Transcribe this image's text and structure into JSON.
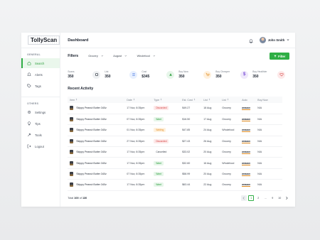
{
  "app": {
    "name": "TollyScan"
  },
  "sidebar": {
    "general_title": "GENERAL",
    "general_items": [
      {
        "label": "Search",
        "icon": "home-icon",
        "active": true
      },
      {
        "label": "Alerts",
        "icon": "bell-icon",
        "active": false
      },
      {
        "label": "Tags",
        "icon": "tag-icon",
        "active": false
      }
    ],
    "others_title": "OTHERS",
    "others_items": [
      {
        "label": "Settings",
        "icon": "gear-icon"
      },
      {
        "label": "Tips",
        "icon": "lightbulb-icon"
      },
      {
        "label": "Tools",
        "icon": "tools-icon"
      },
      {
        "label": "Logout",
        "icon": "logout-icon"
      }
    ]
  },
  "header": {
    "title": "Dashboard",
    "user_name": "John Smith"
  },
  "filters": {
    "label": "Filters",
    "selects": [
      "Grocery",
      "August",
      "Wholefood"
    ],
    "button_label": "Filter"
  },
  "stats": [
    {
      "label": "Scans",
      "value": "350",
      "icon": "scan-icon",
      "color": "#eef0f2",
      "icon_color": "#3c434e"
    },
    {
      "label": "List",
      "value": "350",
      "icon": "list-icon",
      "color": "#e8f0fe",
      "icon_color": "#3b6fe0"
    },
    {
      "label": "Cost",
      "value": "$345",
      "icon": "dollar-icon",
      "color": "#e7f6ea",
      "icon_color": "#2a9d3a"
    },
    {
      "label": "Buy Now",
      "value": "350",
      "icon": "cart-icon",
      "color": "#fff1de",
      "icon_color": "#e08a1e"
    },
    {
      "label": "Buy Cheaper",
      "value": "350",
      "icon": "dollar-circle-icon",
      "color": "#efe8fb",
      "icon_color": "#7a4fd6"
    },
    {
      "label": "Buy Healthier",
      "value": "350",
      "icon": "heart-icon",
      "color": "#fde9e9",
      "icon_color": "#d64545"
    }
  ],
  "recent": {
    "title": "Recent Activity",
    "columns": [
      "Item",
      "Date",
      "Type",
      "Est. Cost",
      "List",
      "List",
      "Auto",
      "Buy Now"
    ],
    "rows": [
      {
        "item": "Skippy Peanut Butter 340z",
        "date": "17 Nov, 8:35pm",
        "type": "Discarded",
        "cost": "$49.27",
        "date2": "18 Aug",
        "list": "Grocery",
        "auto": "amazon",
        "buy": "N/A"
      },
      {
        "item": "Skippy Peanut Butter 340z",
        "date": "07 Nov, 8:35pm",
        "type": "Want",
        "cost": "$16.50",
        "date2": "17 Aug",
        "list": "Grocery",
        "auto": "amazon",
        "buy": "N/A"
      },
      {
        "item": "Skippy Peanut Butter 340z",
        "date": "01 Nov, 8:35pm",
        "type": "Waiting",
        "cost": "$47.85",
        "date2": "24 Aug",
        "list": "Wholefood",
        "auto": "amazon",
        "buy": "N/A"
      },
      {
        "item": "Skippy Peanut Butter 340z",
        "date": "27 Nov, 8:35pm",
        "type": "Discarded",
        "cost": "$27.43",
        "date2": "26 Aug",
        "list": "Grocery",
        "auto": "amazon",
        "buy": "N/A"
      },
      {
        "item": "Skippy Peanut Butter 340z",
        "date": "17 Nov, 8:35pm",
        "type": "Cancelled",
        "cost": "$33.02",
        "date2": "20 Aug",
        "list": "Grocery",
        "auto": "amazon",
        "buy": "N/A"
      },
      {
        "item": "Skippy Peanut Butter 340z",
        "date": "17 Nov, 8:35pm",
        "type": "Want",
        "cost": "$32.60",
        "date2": "16 Aug",
        "list": "Wholefood",
        "auto": "amazon",
        "buy": "N/A"
      },
      {
        "item": "Skippy Peanut Butter 340z",
        "date": "07 Nov, 8:35pm",
        "type": "Want",
        "cost": "$58.99",
        "date2": "20 Aug",
        "list": "Grocery",
        "auto": "amazon",
        "buy": "N/A"
      },
      {
        "item": "Skippy Peanut Butter 340z",
        "date": "17 Nov, 8:35pm",
        "type": "Want",
        "cost": "$63.44",
        "date2": "22 Aug",
        "list": "Grocery",
        "auto": "amazon",
        "buy": "N/A"
      }
    ]
  },
  "footer": {
    "total_label": "Total",
    "total_shown": "100",
    "total_of": "of",
    "total_count": "130",
    "pages": [
      "1",
      "2",
      "...",
      "9",
      "10"
    ],
    "active_page": "1",
    "prev_icon": "chevron-left-icon",
    "next_icon": "chevron-right-icon"
  }
}
